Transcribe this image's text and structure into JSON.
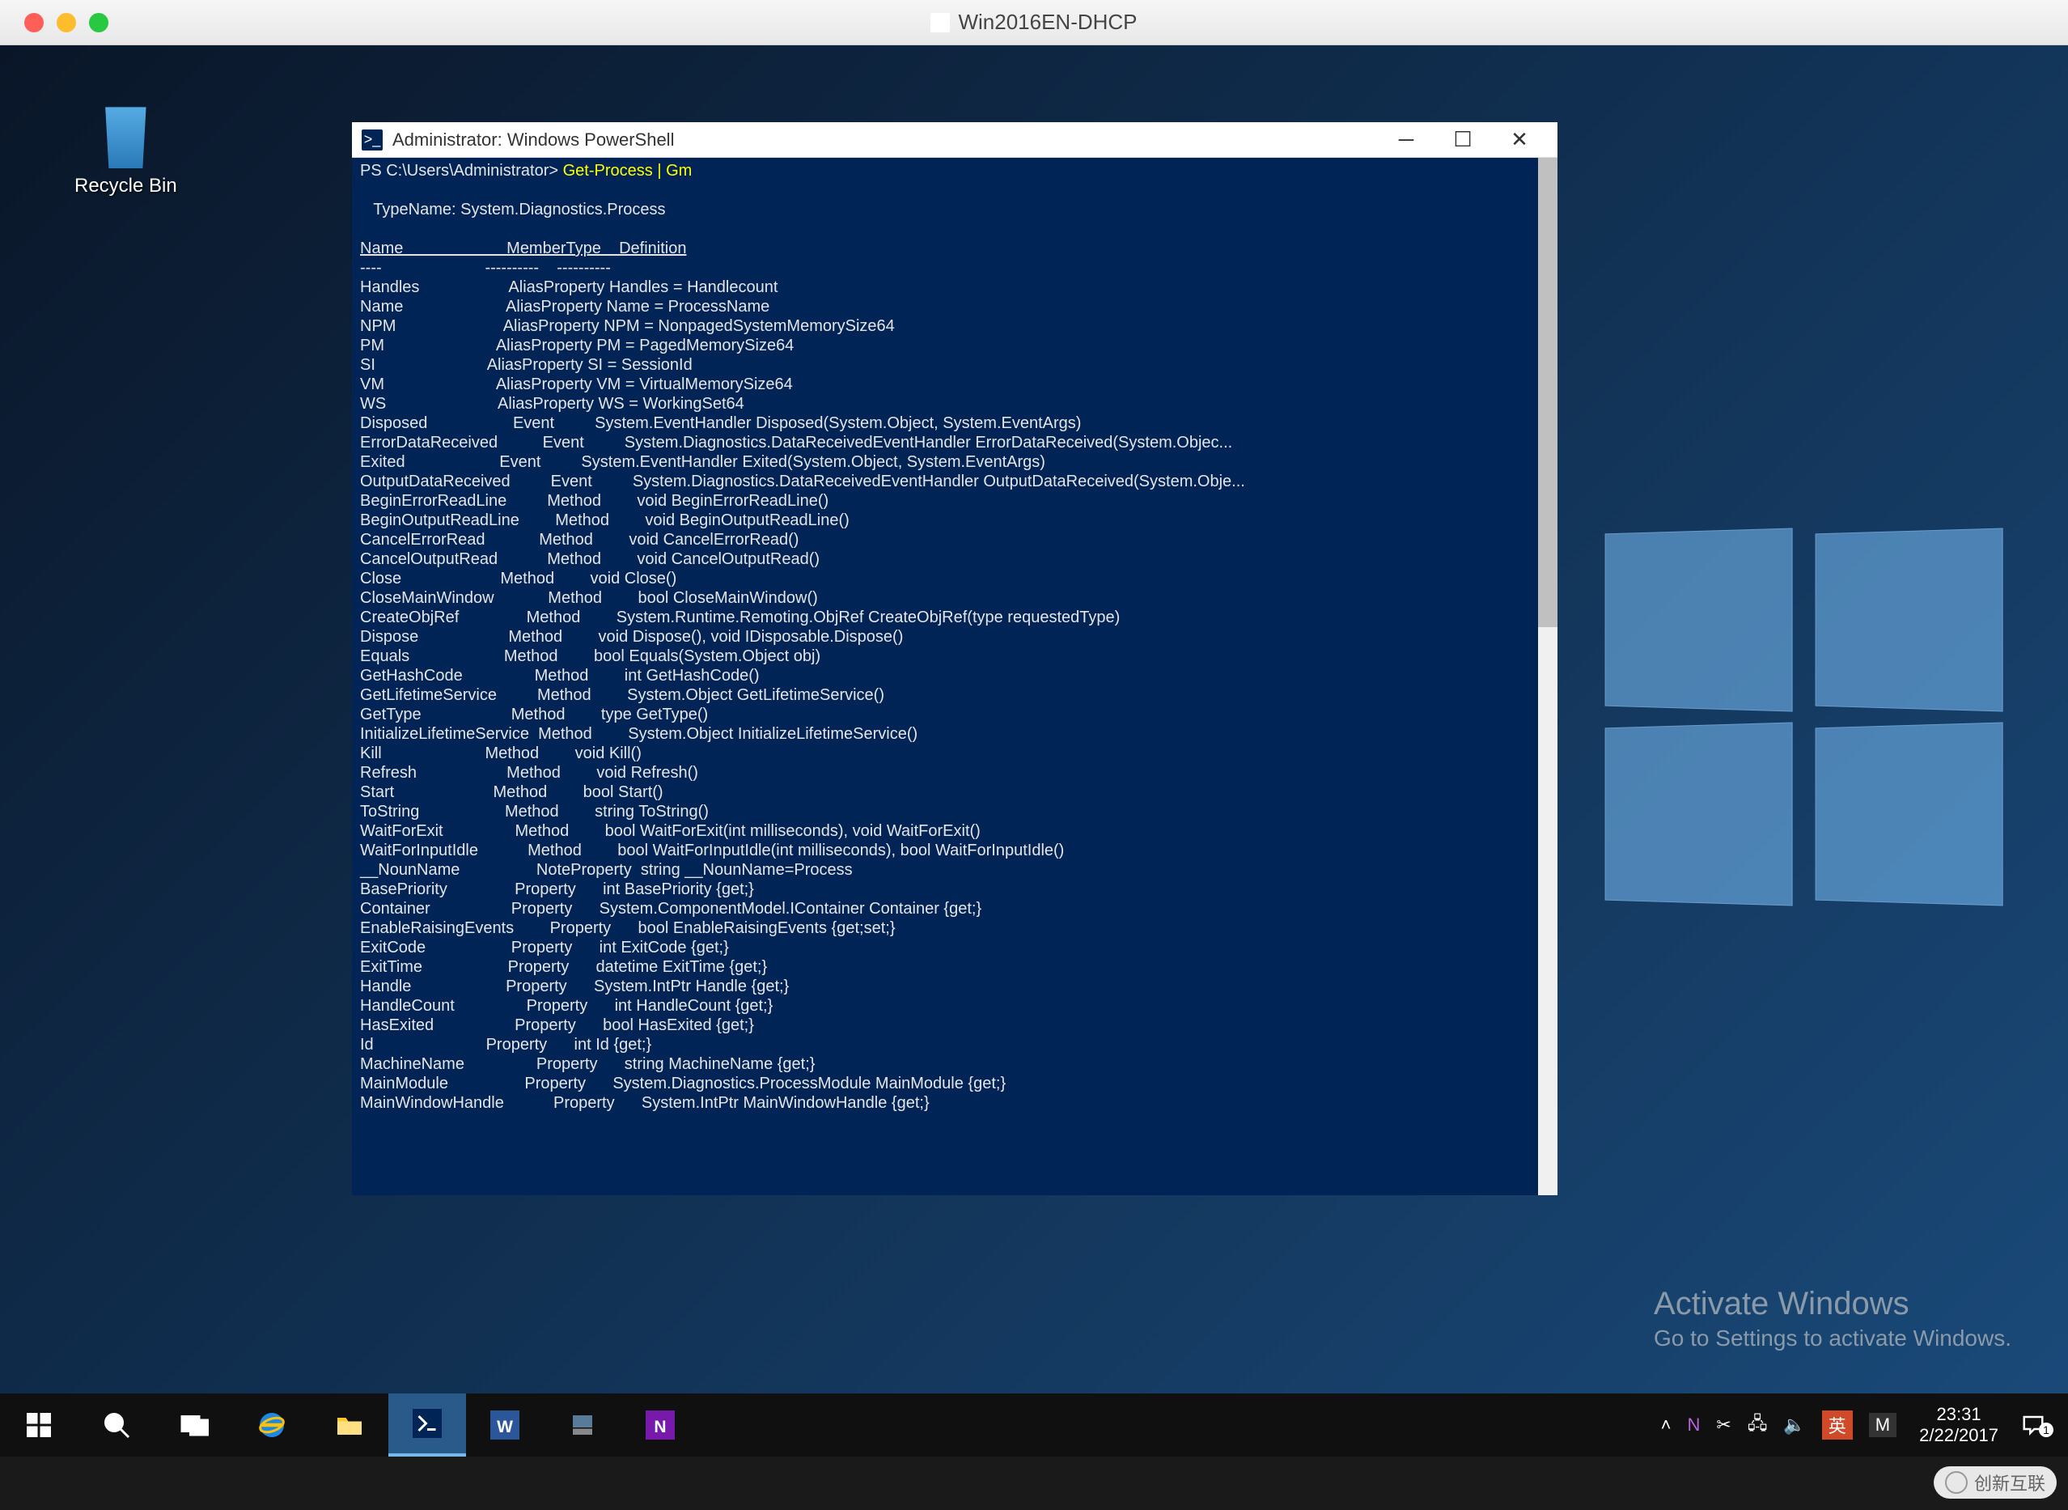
{
  "mac": {
    "title": "Win2016EN-DHCP"
  },
  "desktop": {
    "recycle_bin_label": "Recycle Bin",
    "activate_title": "Activate Windows",
    "activate_sub": "Go to Settings to activate Windows."
  },
  "powershell": {
    "title": "Administrator: Windows PowerShell",
    "icon_glyph": ">_",
    "prompt": "PS C:\\Users\\Administrator> ",
    "command": "Get-Process | Gm",
    "typename_line": "   TypeName: System.Diagnostics.Process",
    "headers": {
      "name": "Name",
      "member": "MemberType",
      "def": "Definition"
    },
    "header_underline": {
      "name": "----",
      "member": "----------",
      "def": "----------"
    },
    "rows": [
      {
        "n": "Handles",
        "m": "AliasProperty",
        "d": "Handles = Handlecount"
      },
      {
        "n": "Name",
        "m": "AliasProperty",
        "d": "Name = ProcessName"
      },
      {
        "n": "NPM",
        "m": "AliasProperty",
        "d": "NPM = NonpagedSystemMemorySize64"
      },
      {
        "n": "PM",
        "m": "AliasProperty",
        "d": "PM = PagedMemorySize64"
      },
      {
        "n": "SI",
        "m": "AliasProperty",
        "d": "SI = SessionId"
      },
      {
        "n": "VM",
        "m": "AliasProperty",
        "d": "VM = VirtualMemorySize64"
      },
      {
        "n": "WS",
        "m": "AliasProperty",
        "d": "WS = WorkingSet64"
      },
      {
        "n": "Disposed",
        "m": "Event",
        "d": "System.EventHandler Disposed(System.Object, System.EventArgs)"
      },
      {
        "n": "ErrorDataReceived",
        "m": "Event",
        "d": "System.Diagnostics.DataReceivedEventHandler ErrorDataReceived(System.Objec..."
      },
      {
        "n": "Exited",
        "m": "Event",
        "d": "System.EventHandler Exited(System.Object, System.EventArgs)"
      },
      {
        "n": "OutputDataReceived",
        "m": "Event",
        "d": "System.Diagnostics.DataReceivedEventHandler OutputDataReceived(System.Obje..."
      },
      {
        "n": "BeginErrorReadLine",
        "m": "Method",
        "d": "void BeginErrorReadLine()"
      },
      {
        "n": "BeginOutputReadLine",
        "m": "Method",
        "d": "void BeginOutputReadLine()"
      },
      {
        "n": "CancelErrorRead",
        "m": "Method",
        "d": "void CancelErrorRead()"
      },
      {
        "n": "CancelOutputRead",
        "m": "Method",
        "d": "void CancelOutputRead()"
      },
      {
        "n": "Close",
        "m": "Method",
        "d": "void Close()"
      },
      {
        "n": "CloseMainWindow",
        "m": "Method",
        "d": "bool CloseMainWindow()"
      },
      {
        "n": "CreateObjRef",
        "m": "Method",
        "d": "System.Runtime.Remoting.ObjRef CreateObjRef(type requestedType)"
      },
      {
        "n": "Dispose",
        "m": "Method",
        "d": "void Dispose(), void IDisposable.Dispose()"
      },
      {
        "n": "Equals",
        "m": "Method",
        "d": "bool Equals(System.Object obj)"
      },
      {
        "n": "GetHashCode",
        "m": "Method",
        "d": "int GetHashCode()"
      },
      {
        "n": "GetLifetimeService",
        "m": "Method",
        "d": "System.Object GetLifetimeService()"
      },
      {
        "n": "GetType",
        "m": "Method",
        "d": "type GetType()"
      },
      {
        "n": "InitializeLifetimeService",
        "m": "Method",
        "d": "System.Object InitializeLifetimeService()"
      },
      {
        "n": "Kill",
        "m": "Method",
        "d": "void Kill()"
      },
      {
        "n": "Refresh",
        "m": "Method",
        "d": "void Refresh()"
      },
      {
        "n": "Start",
        "m": "Method",
        "d": "bool Start()"
      },
      {
        "n": "ToString",
        "m": "Method",
        "d": "string ToString()"
      },
      {
        "n": "WaitForExit",
        "m": "Method",
        "d": "bool WaitForExit(int milliseconds), void WaitForExit()"
      },
      {
        "n": "WaitForInputIdle",
        "m": "Method",
        "d": "bool WaitForInputIdle(int milliseconds), bool WaitForInputIdle()"
      },
      {
        "n": "__NounName",
        "m": "NoteProperty",
        "d": "string __NounName=Process"
      },
      {
        "n": "BasePriority",
        "m": "Property",
        "d": "int BasePriority {get;}"
      },
      {
        "n": "Container",
        "m": "Property",
        "d": "System.ComponentModel.IContainer Container {get;}"
      },
      {
        "n": "EnableRaisingEvents",
        "m": "Property",
        "d": "bool EnableRaisingEvents {get;set;}"
      },
      {
        "n": "ExitCode",
        "m": "Property",
        "d": "int ExitCode {get;}"
      },
      {
        "n": "ExitTime",
        "m": "Property",
        "d": "datetime ExitTime {get;}"
      },
      {
        "n": "Handle",
        "m": "Property",
        "d": "System.IntPtr Handle {get;}"
      },
      {
        "n": "HandleCount",
        "m": "Property",
        "d": "int HandleCount {get;}"
      },
      {
        "n": "HasExited",
        "m": "Property",
        "d": "bool HasExited {get;}"
      },
      {
        "n": "Id",
        "m": "Property",
        "d": "int Id {get;}"
      },
      {
        "n": "MachineName",
        "m": "Property",
        "d": "string MachineName {get;}"
      },
      {
        "n": "MainModule",
        "m": "Property",
        "d": "System.Diagnostics.ProcessModule MainModule {get;}"
      },
      {
        "n": "MainWindowHandle",
        "m": "Property",
        "d": "System.IntPtr MainWindowHandle {get;}"
      }
    ]
  },
  "taskbar": {
    "time": "23:31",
    "date": "2/22/2017",
    "ime_lang": "英",
    "ime_kb": "M",
    "notif_count": "1"
  },
  "tray_icons": {
    "chevron": "˄",
    "onenote": "N",
    "scissors": "✂",
    "net": "🖧",
    "sound": "🔈"
  },
  "watermark": "创新互联"
}
